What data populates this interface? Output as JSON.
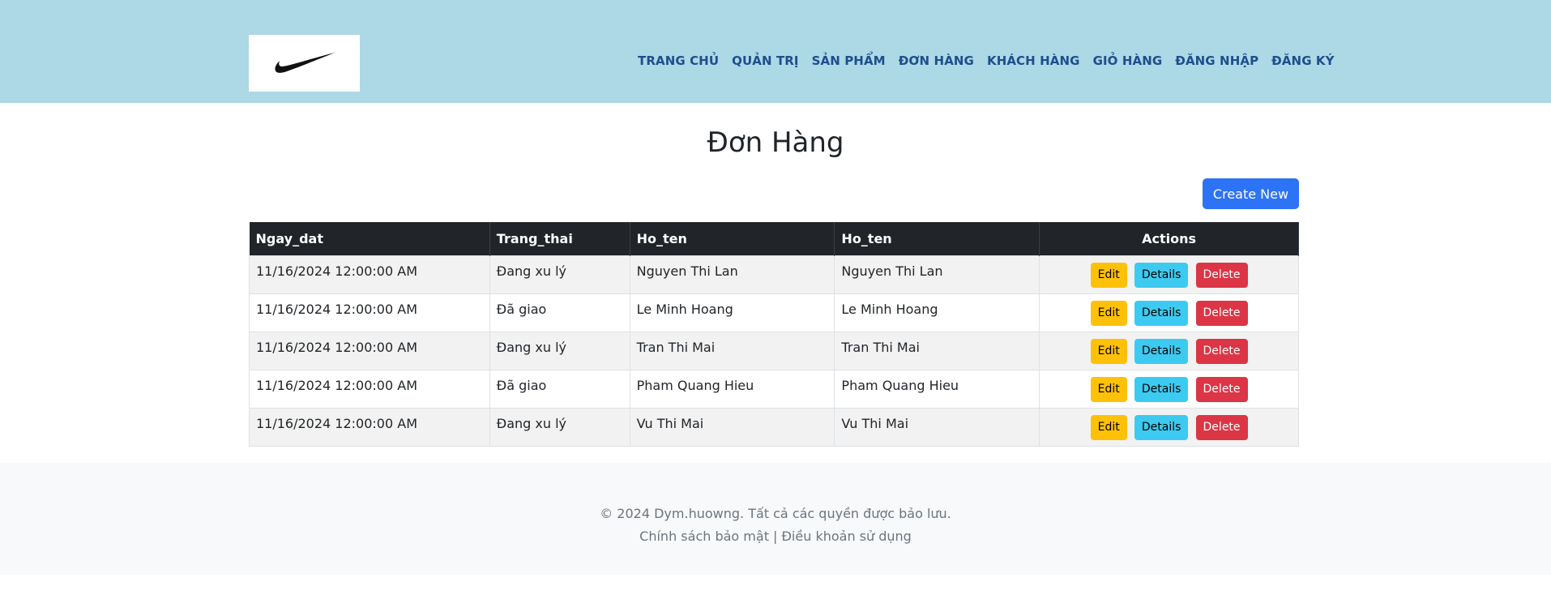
{
  "header": {
    "logo_name": "swoosh-logo",
    "nav": [
      "TRANG CHỦ",
      "QUẢN TRỊ",
      "SẢN PHẨM",
      "ĐƠN HÀNG",
      "KHÁCH HÀNG",
      "GIỎ HÀNG",
      "ĐĂNG NHẬP",
      "ĐĂNG KÝ"
    ]
  },
  "main": {
    "title": "Đơn Hàng",
    "create_label": "Create New",
    "table": {
      "columns": [
        "Ngay_dat",
        "Trang_thai",
        "Ho_ten",
        "Ho_ten",
        "Actions"
      ],
      "rows": [
        {
          "ngay_dat": "11/16/2024 12:00:00 AM",
          "trang_thai": "Đang xu lý",
          "ho_ten_1": "Nguyen Thi Lan",
          "ho_ten_2": "Nguyen Thi Lan"
        },
        {
          "ngay_dat": "11/16/2024 12:00:00 AM",
          "trang_thai": "Đã giao",
          "ho_ten_1": "Le Minh Hoang",
          "ho_ten_2": "Le Minh Hoang"
        },
        {
          "ngay_dat": "11/16/2024 12:00:00 AM",
          "trang_thai": "Đang xu lý",
          "ho_ten_1": "Tran Thi Mai",
          "ho_ten_2": "Tran Thi Mai"
        },
        {
          "ngay_dat": "11/16/2024 12:00:00 AM",
          "trang_thai": "Đã giao",
          "ho_ten_1": "Pham Quang Hieu",
          "ho_ten_2": "Pham Quang Hieu"
        },
        {
          "ngay_dat": "11/16/2024 12:00:00 AM",
          "trang_thai": "Đang xu lý",
          "ho_ten_1": "Vu Thi Mai",
          "ho_ten_2": "Vu Thi Mai"
        }
      ],
      "actions": {
        "edit": "Edit",
        "details": "Details",
        "delete": "Delete"
      }
    }
  },
  "footer": {
    "copyright": "© 2024 Dym.huowng. Tất cả các quyền được bảo lưu.",
    "links": "Chính sách bảo mật | Điều khoản sử dụng"
  },
  "colors": {
    "header_bg": "#add8e6",
    "nav_text": "#1e4e8c",
    "primary": "#2d73f5",
    "edit": "#ffc107",
    "details": "#3dcaf0",
    "delete": "#dc3545",
    "table_head": "#212529"
  }
}
